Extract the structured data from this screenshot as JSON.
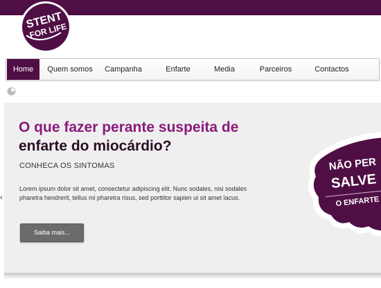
{
  "brand": {
    "logo_line1": "STENT",
    "logo_line2": "FOR LIFE",
    "color_primary": "#4f0f45",
    "color_accent": "#8a1a7c"
  },
  "nav": {
    "items": [
      {
        "label": "Home",
        "active": true
      },
      {
        "label": "Quem somos",
        "active": false
      },
      {
        "label": "Campanha",
        "active": false
      },
      {
        "label": "Enfarte",
        "active": false
      },
      {
        "label": "Media",
        "active": false
      },
      {
        "label": "Parceiros",
        "active": false
      },
      {
        "label": "Contactos",
        "active": false
      }
    ]
  },
  "hero": {
    "headline_line1": "O que fazer perante suspeita de",
    "headline_line2": "enfarte do miocárdio?",
    "subtitle": "CONHECA OS SINTOMAS",
    "body": "Lorem ipsum dolor sit amet, consectetur adipiscing elit. Nunc sodales, nisi sodales pharetra hendrerit, tellus mi pharetra risus, sed porttitor sapien ui sit amet lacus.",
    "button_label": "Saiba mais...",
    "prev_arrow": "‹"
  },
  "sticker": {
    "line1": "NÃO PER",
    "line2": "SALVE",
    "line3": "O ENFARTE"
  },
  "icons": {
    "loader": "loader-icon",
    "prev": "chevron-left-icon"
  }
}
